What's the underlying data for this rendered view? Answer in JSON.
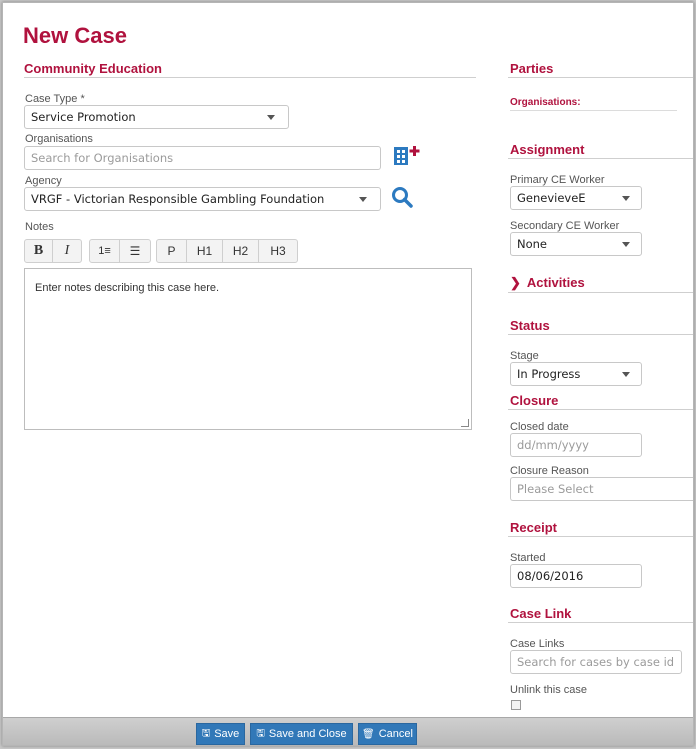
{
  "page": {
    "title": "New Case"
  },
  "main": {
    "section_title": "Community Education",
    "case_type": {
      "label": "Case Type *",
      "value": "Service Promotion"
    },
    "organisations": {
      "label": "Organisations",
      "placeholder": "Search for Organisations"
    },
    "agency": {
      "label": "Agency",
      "value": "VRGF - Victorian Responsible Gambling Foundation"
    },
    "notes": {
      "label": "Notes",
      "placeholder": "Enter notes describing this case here."
    },
    "toolbar": {
      "bold": "B",
      "italic": "I",
      "ordered_list": "1≡",
      "unordered_list": "☰",
      "p": "P",
      "h1": "H1",
      "h2": "H2",
      "h3": "H3"
    }
  },
  "sidebar": {
    "parties": {
      "title": "Parties",
      "organisations_label": "Organisations:"
    },
    "assignment": {
      "title": "Assignment",
      "primary_label": "Primary CE Worker",
      "primary_value": "GenevieveE",
      "secondary_label": "Secondary CE Worker",
      "secondary_value": "None"
    },
    "activities": {
      "title": "Activities"
    },
    "status": {
      "title": "Status",
      "stage_label": "Stage",
      "stage_value": "In Progress"
    },
    "closure": {
      "title": "Closure",
      "closed_date_label": "Closed date",
      "closed_date_placeholder": "dd/mm/yyyy",
      "reason_label": "Closure Reason",
      "reason_value": "Please Select"
    },
    "receipt": {
      "title": "Receipt",
      "started_label": "Started",
      "started_value": "08/06/2016"
    },
    "case_link": {
      "title": "Case Link",
      "links_label": "Case Links",
      "links_placeholder": "Search for cases by case id",
      "unlink_label": "Unlink this case"
    }
  },
  "footer": {
    "save": "Save",
    "save_close": "Save and Close",
    "cancel": "Cancel"
  },
  "colors": {
    "accent": "#b0123e",
    "button": "#3178b8",
    "icon": "#2c7ac0"
  }
}
